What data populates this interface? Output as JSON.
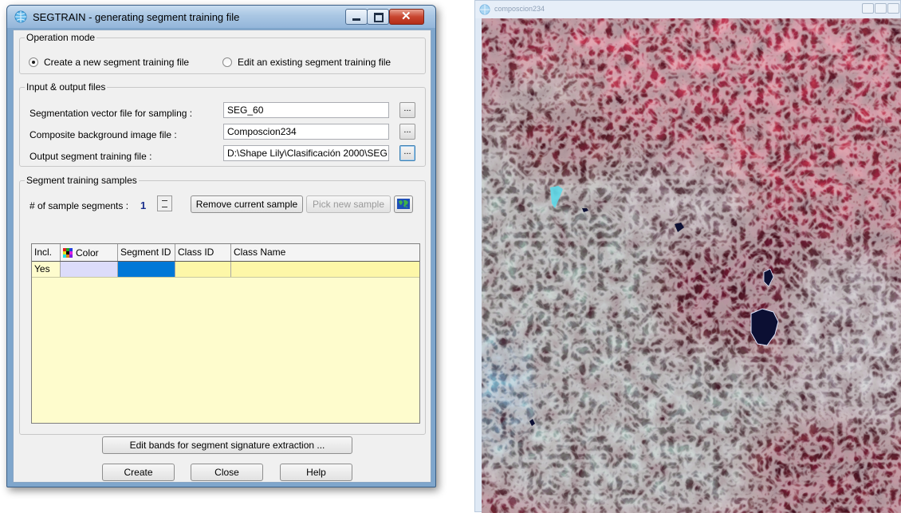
{
  "dialog": {
    "title": "SEGTRAIN - generating segment training file",
    "operation_mode": {
      "legend": "Operation mode",
      "option_create": "Create a new segment training file",
      "option_edit": "Edit an existing segment training file",
      "selected": "create"
    },
    "files": {
      "legend": "Input & output files",
      "seg_label": "Segmentation vector file for sampling :",
      "seg_value": "SEG_60",
      "bg_label": "Composite background image file :",
      "bg_value": "Composcion234",
      "out_label": "Output segment training file :",
      "out_value": "D:\\Shape Lily\\Clasificación 2000\\SEG",
      "browse": "..."
    },
    "samples": {
      "legend": "Segment training samples",
      "count_label": "# of sample segments :",
      "count_value": "1",
      "remove_button": "Remove current sample",
      "pick_button": "Pick new sample",
      "columns": [
        "Incl.",
        "Color",
        "Segment ID",
        "Class ID",
        "Class Name"
      ],
      "rows": [
        {
          "incl": "Yes",
          "color": "",
          "segment_id": "",
          "class_id": "",
          "class_name": ""
        }
      ]
    },
    "edit_bands_button": "Edit bands for segment signature extraction ...",
    "create_button": "Create",
    "close_button": "Close",
    "help_button": "Help"
  },
  "viewer": {
    "title": "composcion234"
  },
  "colors": {
    "grid_background": "#fefccd",
    "selected_cell": "#0078d7",
    "color_cell": "#dcdcfa",
    "count_value": "#1a2f8c"
  }
}
